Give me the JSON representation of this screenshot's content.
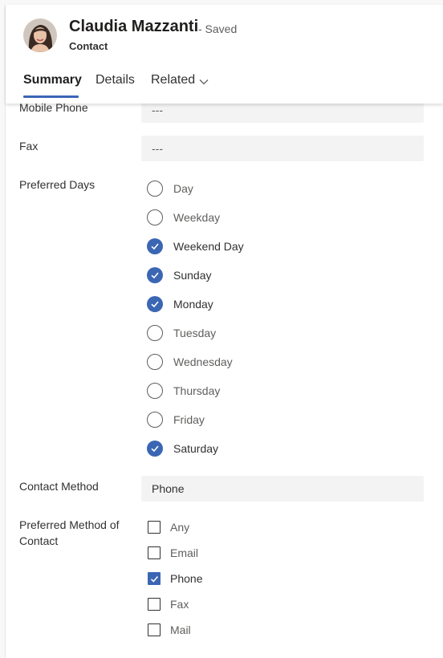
{
  "record": {
    "name": "Claudia Mazzanti",
    "status": "- Saved",
    "entity": "Contact"
  },
  "tabs": [
    "Summary",
    "Details",
    "Related"
  ],
  "fields": {
    "mobile_phone": {
      "label": "Mobile Phone",
      "value": "---"
    },
    "fax": {
      "label": "Fax",
      "value": "---"
    },
    "preferred_days": {
      "label": "Preferred Days",
      "options": [
        {
          "label": "Day",
          "checked": false
        },
        {
          "label": "Weekday",
          "checked": false
        },
        {
          "label": "Weekend Day",
          "checked": true
        },
        {
          "label": "Sunday",
          "checked": true
        },
        {
          "label": "Monday",
          "checked": true
        },
        {
          "label": "Tuesday",
          "checked": false
        },
        {
          "label": "Wednesday",
          "checked": false
        },
        {
          "label": "Thursday",
          "checked": false
        },
        {
          "label": "Friday",
          "checked": false
        },
        {
          "label": "Saturday",
          "checked": true
        }
      ]
    },
    "contact_method": {
      "label": "Contact Method",
      "value": "Phone"
    },
    "preferred_method": {
      "label_line1": "Preferred Method of",
      "label_line2": "Contact",
      "options": [
        {
          "label": "Any",
          "checked": false
        },
        {
          "label": "Email",
          "checked": false
        },
        {
          "label": "Phone",
          "checked": true
        },
        {
          "label": "Fax",
          "checked": false
        },
        {
          "label": "Mail",
          "checked": false
        }
      ]
    }
  },
  "colors": {
    "accent": "#3b66b4",
    "field_bg": "#f3f3f3"
  },
  "icons": {
    "tab_related": "chevron-down-icon",
    "radio_check": "checkmark-icon",
    "box_check": "checkmark-icon"
  }
}
